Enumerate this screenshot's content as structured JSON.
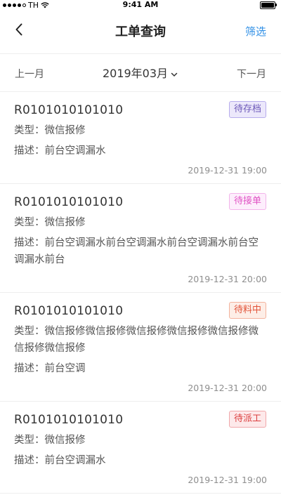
{
  "status_bar": {
    "carrier": "TH",
    "time": "9:41 AM"
  },
  "nav": {
    "title": "工单查询",
    "filter_label": "筛选"
  },
  "month_bar": {
    "prev_label": "上一月",
    "current_month": "2019年03月",
    "next_label": "下一月"
  },
  "labels": {
    "type": "类型：",
    "desc": "描述："
  },
  "orders": [
    {
      "id": "R0101010101010",
      "status": "待存档",
      "status_color": "#6c58b8",
      "type": "微信报修",
      "desc": "前台空调漏水",
      "time": "2019-12-31 19:00"
    },
    {
      "id": "R0101010101010",
      "status": "待接单",
      "status_color": "#e052c4",
      "type": "微信报修",
      "desc": "前台空调漏水前台空调漏水前台空调漏水前台空调漏水前台",
      "time": "2019-12-31 20:00"
    },
    {
      "id": "R0101010101010",
      "status": "待料中",
      "status_color": "#e2543a",
      "type": "微信报修微信报修微信报修微信报修微信报修微信报修微信报修",
      "desc": "前台空调",
      "time": "2019-12-31 20:00"
    },
    {
      "id": "R0101010101010",
      "status": "待派工",
      "status_color": "#dc3e3e",
      "type": "微信报修",
      "desc": "前台空调漏水",
      "time": "2019-12-31 19:00"
    }
  ]
}
